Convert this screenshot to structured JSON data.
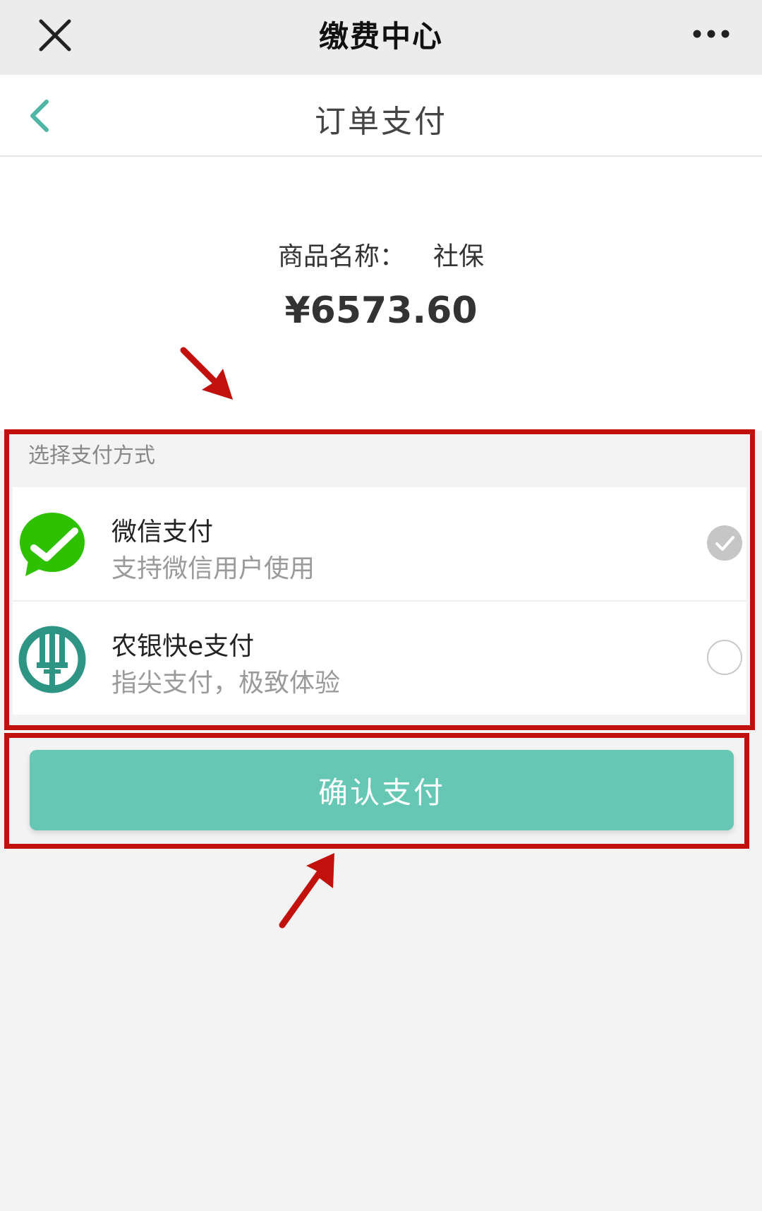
{
  "topbar": {
    "title": "缴费中心"
  },
  "header": {
    "title": "订单支付"
  },
  "summary": {
    "product_label": "商品名称：",
    "product_name": "社保",
    "price": "¥6573.60"
  },
  "payment": {
    "section_title": "选择支付方式",
    "methods": [
      {
        "title": "微信支付",
        "subtitle": "支持微信用户使用",
        "selected": true
      },
      {
        "title": "农银快e支付",
        "subtitle": "指尖支付，极致体验",
        "selected": false
      }
    ]
  },
  "confirm_button": {
    "label": "确认支付"
  },
  "colors": {
    "accent": "#65c7b4",
    "wechat_green": "#2dc100",
    "abc_green": "#2e9483",
    "annotation_red": "#c2100c"
  },
  "icons": [
    "close-icon",
    "more-icon",
    "back-chevron-icon",
    "wechat-pay-icon",
    "abc-bank-icon",
    "check-icon"
  ]
}
